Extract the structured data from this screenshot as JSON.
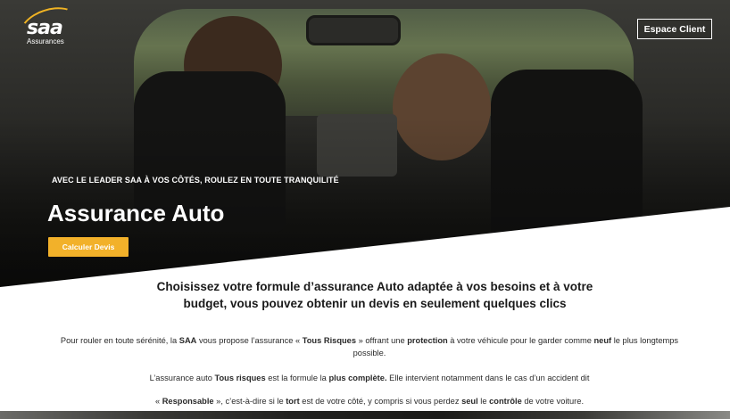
{
  "brand": {
    "logo_text": "saa",
    "logo_sub": "Assurances",
    "accent": "#f2b12a"
  },
  "header": {
    "espace_client": "Espace Client"
  },
  "hero": {
    "tagline": "AVEC LE LEADER SAA À VOS CÔTÉS, ROULEZ EN TOUTE TRANQUILITÉ",
    "title": "Assurance Auto",
    "cta": "Calculer Devis"
  },
  "content": {
    "headline": "Choisissez votre formule d’assurance Auto adaptée à vos besoins et à votre budget, vous pouvez obtenir un devis en seulement quelques clics",
    "p1": {
      "a": "Pour rouler en toute sérénité, la ",
      "b": "SAA",
      "c": " vous propose l’assurance  « ",
      "d": "Tous Risques",
      "e": " » offrant une ",
      "f": "protection",
      "g": " à votre véhicule pour le garder comme ",
      "h": "neuf",
      "i": " le plus longtemps possible."
    },
    "p2": {
      "a": "L’assurance auto ",
      "b": "Tous risques",
      "c": " est la formule la ",
      "d": "plus complète.",
      "e": " Elle intervient notamment dans le cas d’un accident dit"
    },
    "p3": {
      "a": "« ",
      "b": "Responsable",
      "c": " », c’est-à-dire si le ",
      "d": "tort",
      "e": " est de votre côté, y compris si vous perdez ",
      "f": "seul",
      "g": " le ",
      "h": "contrôle",
      "i": " de votre voiture."
    }
  }
}
